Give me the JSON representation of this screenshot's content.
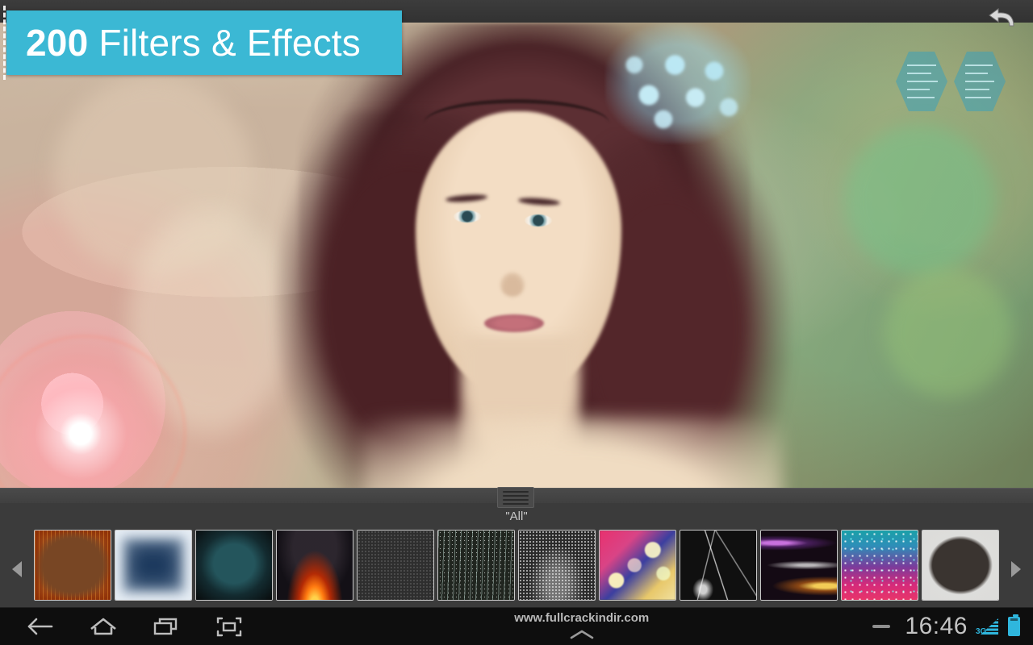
{
  "app": {
    "banner": {
      "count": "200",
      "text": "Filters & Effects"
    },
    "undo_icon": "undo-arrow-icon"
  },
  "canvas": {
    "photo_description": "Portrait of a woman with long dark brown hair and a light-blue flower hairpiece on a warm bokeh background",
    "overlay_icons": [
      "hexagon-left",
      "hexagon-right"
    ],
    "flare": "pink-lens-flare"
  },
  "filter_panel": {
    "grip_icon": "drag-handle-icon",
    "category_label": "\"All\"",
    "scroll_left_icon": "chevron-left-icon",
    "scroll_right_icon": "chevron-right-icon",
    "thumbnails": [
      {
        "name": "rust-frame",
        "class": "t-rust"
      },
      {
        "name": "ice-frame",
        "class": "t-ice"
      },
      {
        "name": "teal-vignette",
        "class": "t-teal"
      },
      {
        "name": "fire",
        "class": "t-fire"
      },
      {
        "name": "grain-noise",
        "class": "t-grain"
      },
      {
        "name": "rain-streaks",
        "class": "t-rain"
      },
      {
        "name": "dust-glow",
        "class": "t-dust"
      },
      {
        "name": "color-bokeh",
        "class": "t-bokeh"
      },
      {
        "name": "lightning-cracks",
        "class": "t-crack"
      },
      {
        "name": "light-streaks",
        "class": "t-streak"
      },
      {
        "name": "glitter-confetti",
        "class": "t-glitter"
      },
      {
        "name": "grunge-frame",
        "class": "t-grunge"
      }
    ]
  },
  "navbar": {
    "back_icon": "back-arrow-icon",
    "home_icon": "home-icon",
    "recents_icon": "recent-apps-icon",
    "screenshot_icon": "screenshot-icon",
    "watermark": "www.fullcrackindir.com",
    "expand_icon": "chevron-up-icon",
    "minus_icon": "minus-icon",
    "time": "16:46",
    "network": "3G",
    "battery_icon": "battery-full-icon"
  },
  "colors": {
    "banner_bg": "#3bb8d4",
    "panel_bg": "#3b3b3b",
    "navbar_bg": "#0e0e0e",
    "status_accent": "#2fb6dd",
    "text_light": "#c9c9c9"
  }
}
